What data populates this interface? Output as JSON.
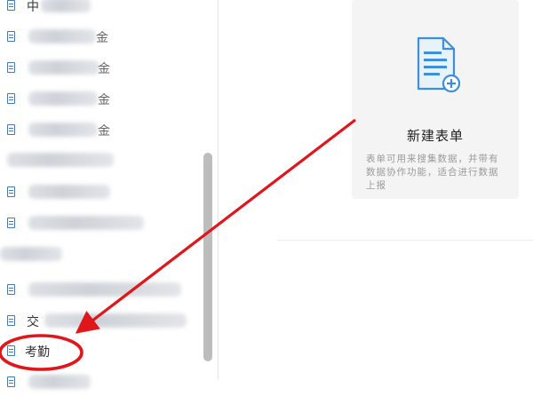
{
  "sidebar": {
    "items": [
      {
        "label": "中",
        "tail": ""
      },
      {
        "label": "",
        "tail": "金"
      },
      {
        "label": "",
        "tail": "金"
      },
      {
        "label": "",
        "tail": "金"
      },
      {
        "label": "",
        "tail": "金"
      },
      {
        "label": "",
        "tail": ""
      },
      {
        "label": "",
        "tail": ""
      },
      {
        "label": "",
        "tail": ""
      },
      {
        "label": "",
        "tail": ""
      },
      {
        "label": "",
        "tail": ""
      },
      {
        "label": "交",
        "tail": ""
      },
      {
        "label": "考勤",
        "tail": ""
      }
    ]
  },
  "new_form_card": {
    "icon": "form-plus-icon",
    "title": "新建表单",
    "description": "表单可用来搜集数据，并带有数据协作功能，适合进行数据上报"
  },
  "annotation": {
    "color": "#e0161b"
  }
}
